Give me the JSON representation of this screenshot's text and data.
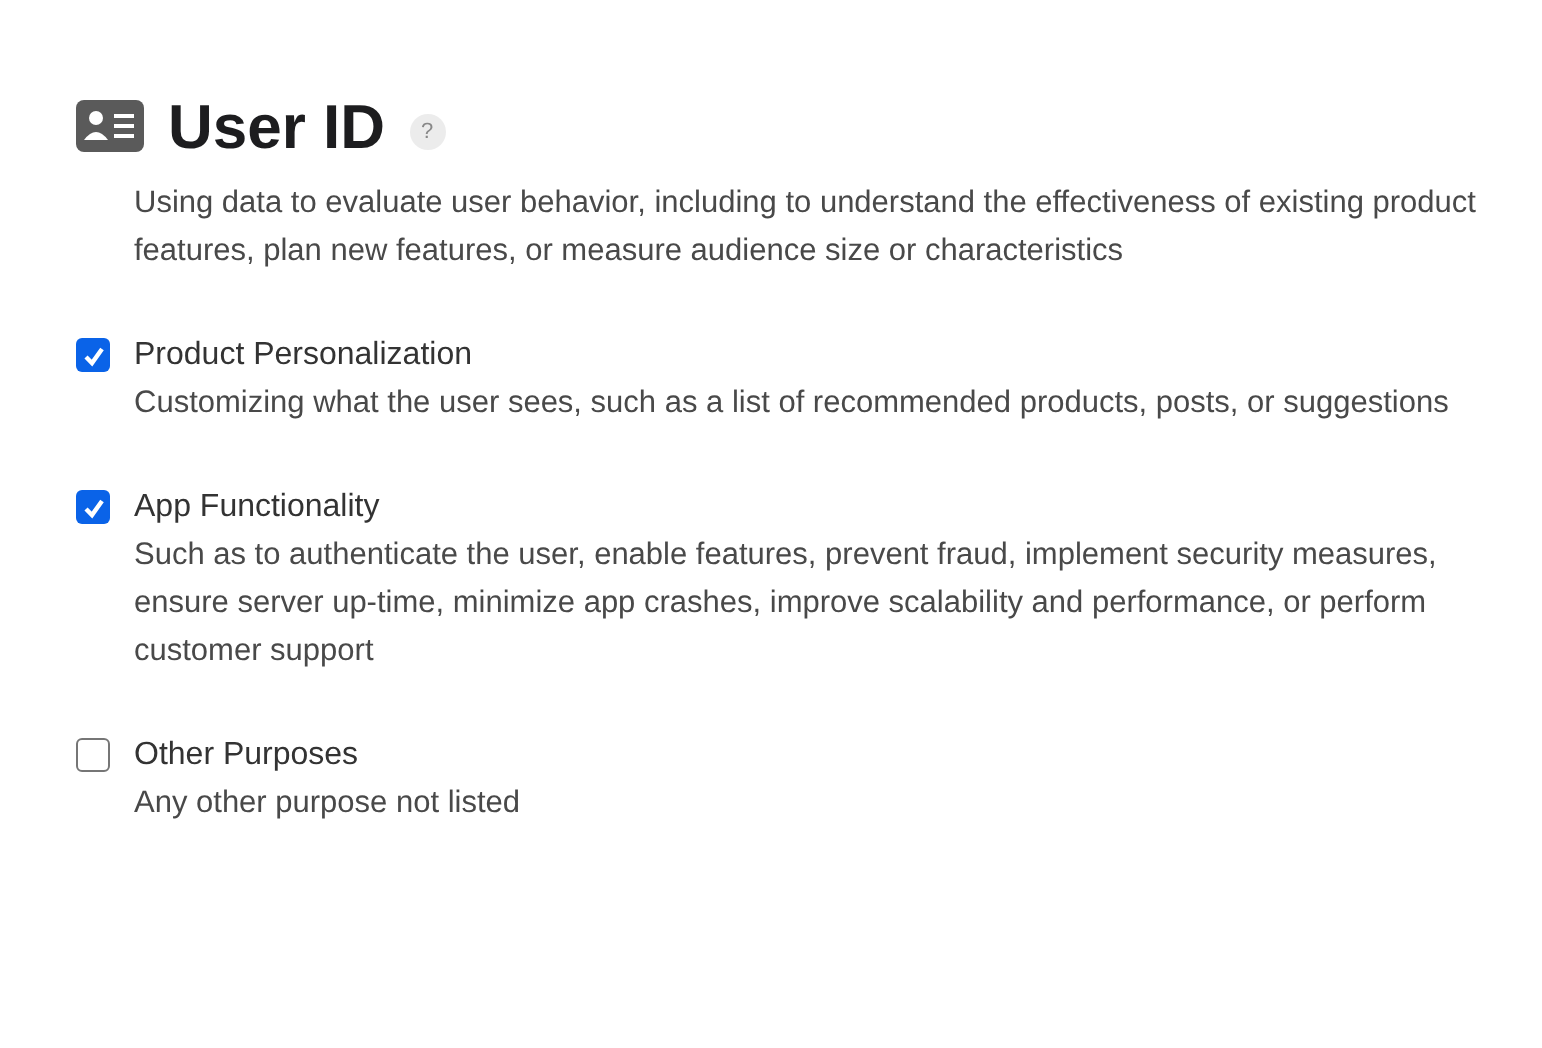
{
  "header": {
    "title": "User ID",
    "help": "?"
  },
  "purposes": [
    {
      "description": "Using data to evaluate user behavior, including to understand the effectiveness of existing product features, plan new features, or measure audience size or characteristics"
    },
    {
      "label": "Product Personalization",
      "checked": true,
      "description": "Customizing what the user sees, such as a list of recommended products, posts, or suggestions"
    },
    {
      "label": "App Functionality",
      "checked": true,
      "description": "Such as to authenticate the user, enable features, prevent fraud, implement security measures, ensure server up-time, minimize app crashes, improve scalability and performance, or perform customer support"
    },
    {
      "label": "Other Purposes",
      "checked": false,
      "description": "Any other purpose not listed"
    }
  ]
}
